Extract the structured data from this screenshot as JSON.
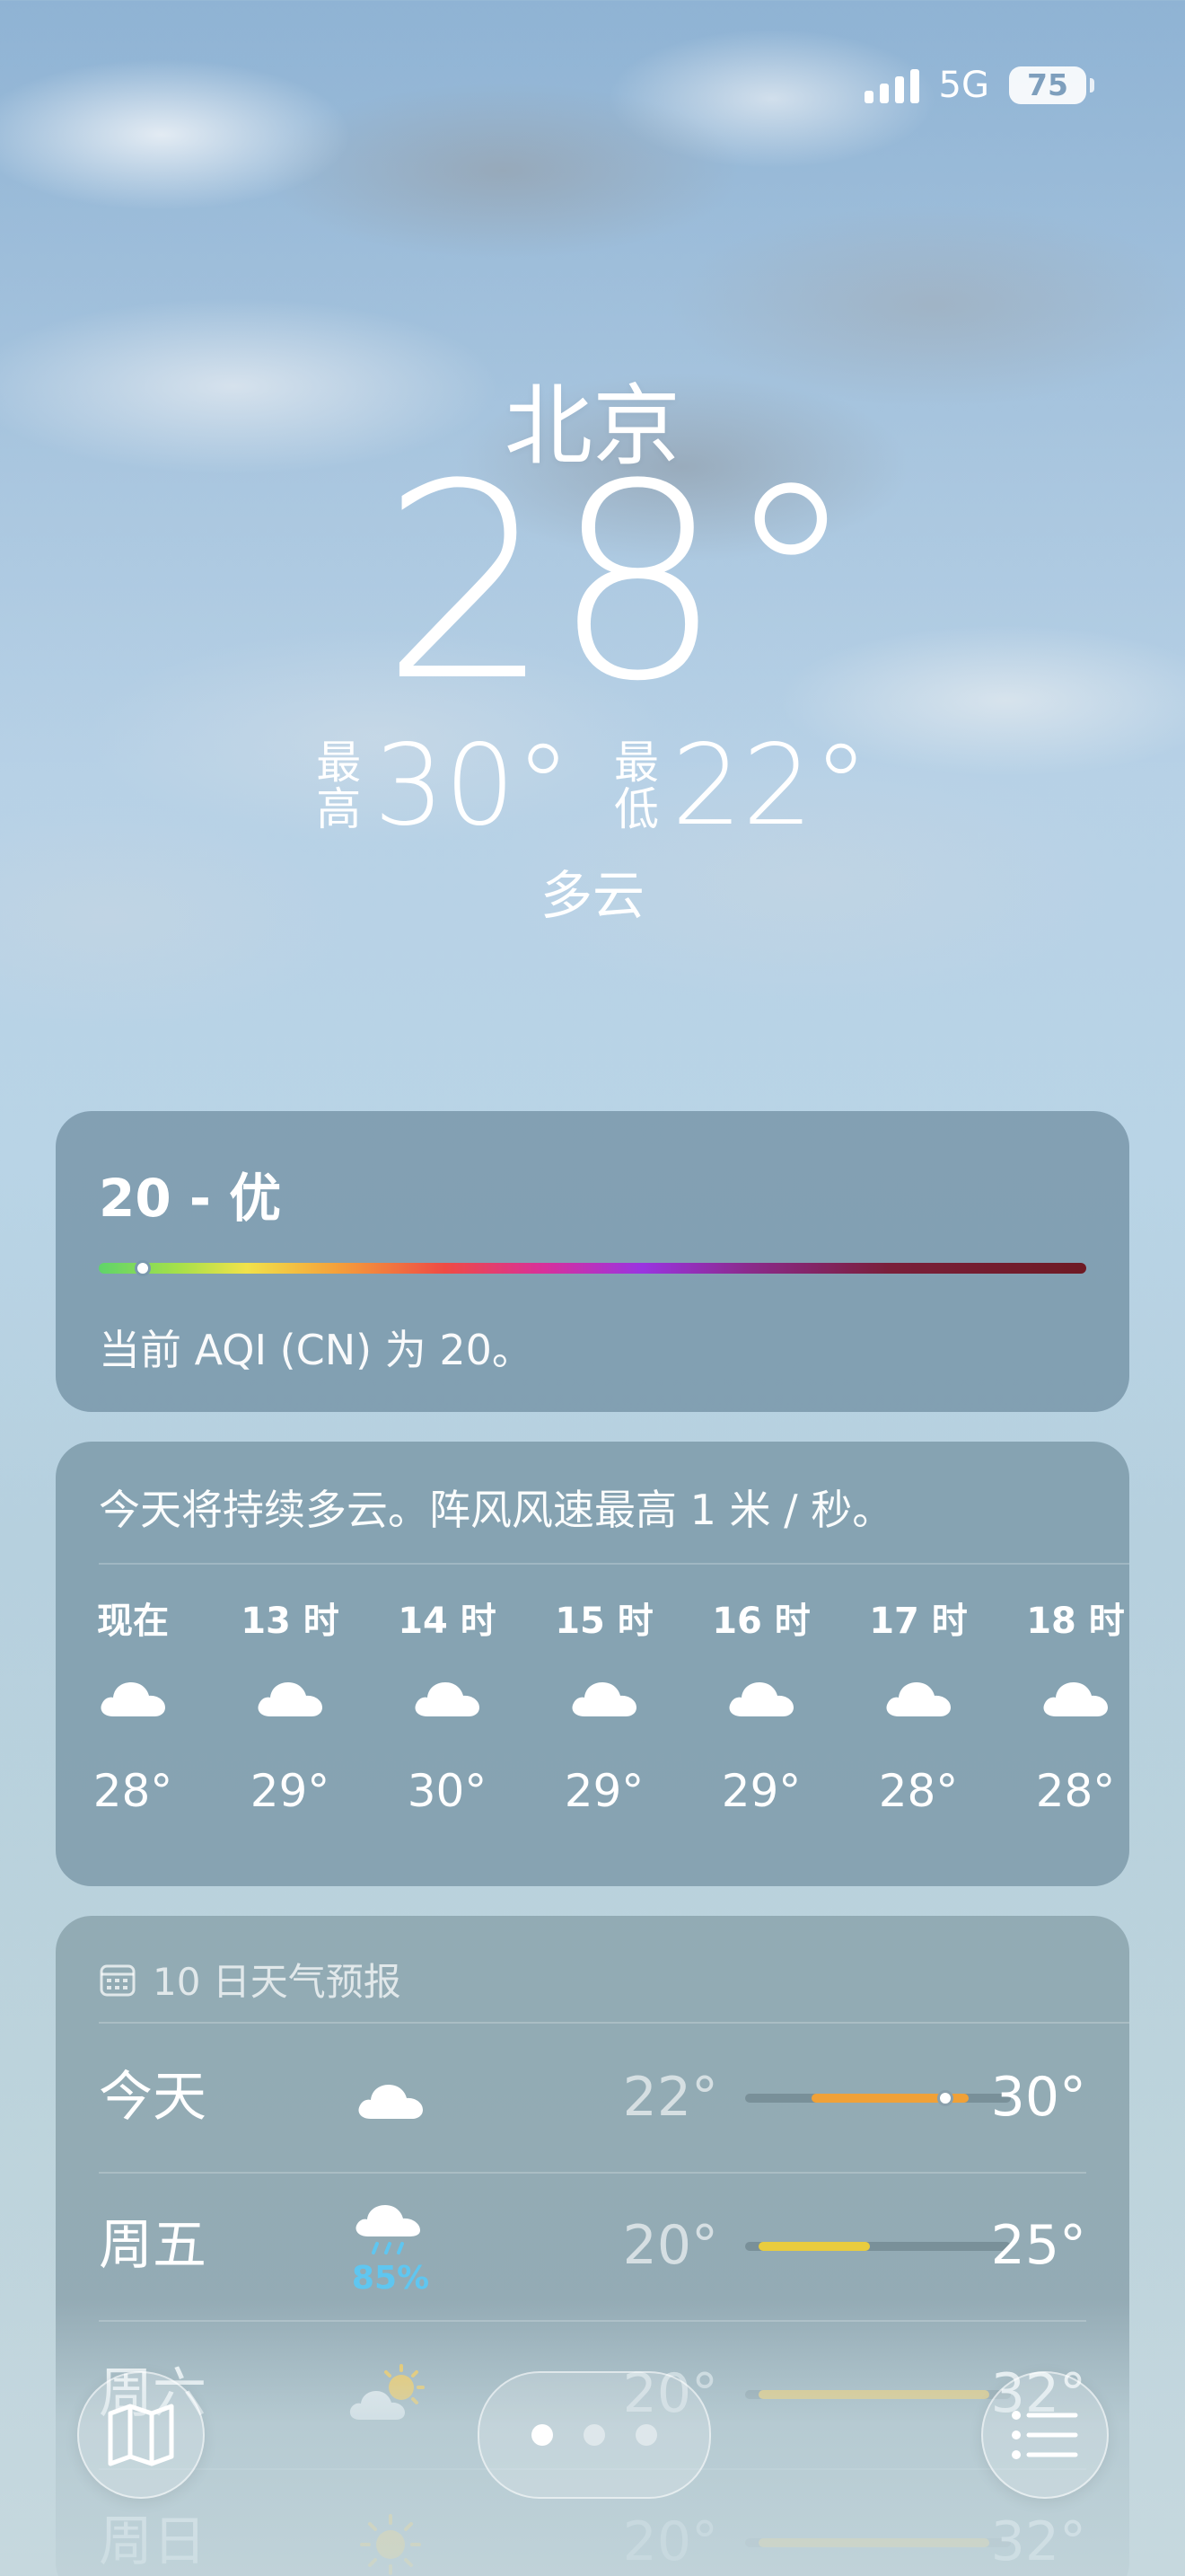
{
  "status_bar": {
    "network": "5G",
    "battery": "75"
  },
  "weather": {
    "city": "北京",
    "temp": "28°",
    "high_label": "最高",
    "high": "30°",
    "low_label": "最低",
    "low": "22°",
    "condition": "多云"
  },
  "aqi": {
    "title": "20 - 优",
    "value": 20,
    "description": "当前 AQI (CN) 为 20。"
  },
  "hourly": {
    "summary": "今天将持续多云。阵风风速最高 1 米 / 秒。",
    "hours": [
      {
        "label": "现在",
        "icon": "cloud-icon",
        "temp": "28°"
      },
      {
        "label": "13 时",
        "icon": "cloud-icon",
        "temp": "29°"
      },
      {
        "label": "14 时",
        "icon": "cloud-icon",
        "temp": "30°"
      },
      {
        "label": "15 时",
        "icon": "cloud-icon",
        "temp": "29°"
      },
      {
        "label": "16 时",
        "icon": "cloud-icon",
        "temp": "29°"
      },
      {
        "label": "17 时",
        "icon": "cloud-icon",
        "temp": "28°"
      },
      {
        "label": "18 时",
        "icon": "cloud-icon",
        "temp": "28°"
      }
    ]
  },
  "daily": {
    "header": "10 日天气预报",
    "days": [
      {
        "name": "今天",
        "icon": "cloud-icon",
        "pop": "",
        "low": "22°",
        "high": "30°",
        "range_start": 0.25,
        "range_end": 0.84,
        "now": 0.75,
        "color": "#f0a138"
      },
      {
        "name": "周五",
        "icon": "cloud-rain-icon",
        "pop": "85%",
        "low": "20°",
        "high": "25°",
        "range_start": 0.05,
        "range_end": 0.47,
        "color": "#e9cc3e"
      },
      {
        "name": "周六",
        "icon": "sun-cloud-icon",
        "pop": "",
        "low": "20°",
        "high": "32°",
        "range_start": 0.05,
        "range_end": 0.92,
        "color": "#e8c25a"
      },
      {
        "name": "周日",
        "icon": "sun-icon",
        "pop": "",
        "low": "20°",
        "high": "32°",
        "range_start": 0.05,
        "range_end": 0.92,
        "color": "#e8c25a"
      }
    ]
  },
  "nav": {
    "map_icon": "map-icon",
    "list_icon": "list-icon",
    "pages": 3,
    "active_page": 0
  }
}
